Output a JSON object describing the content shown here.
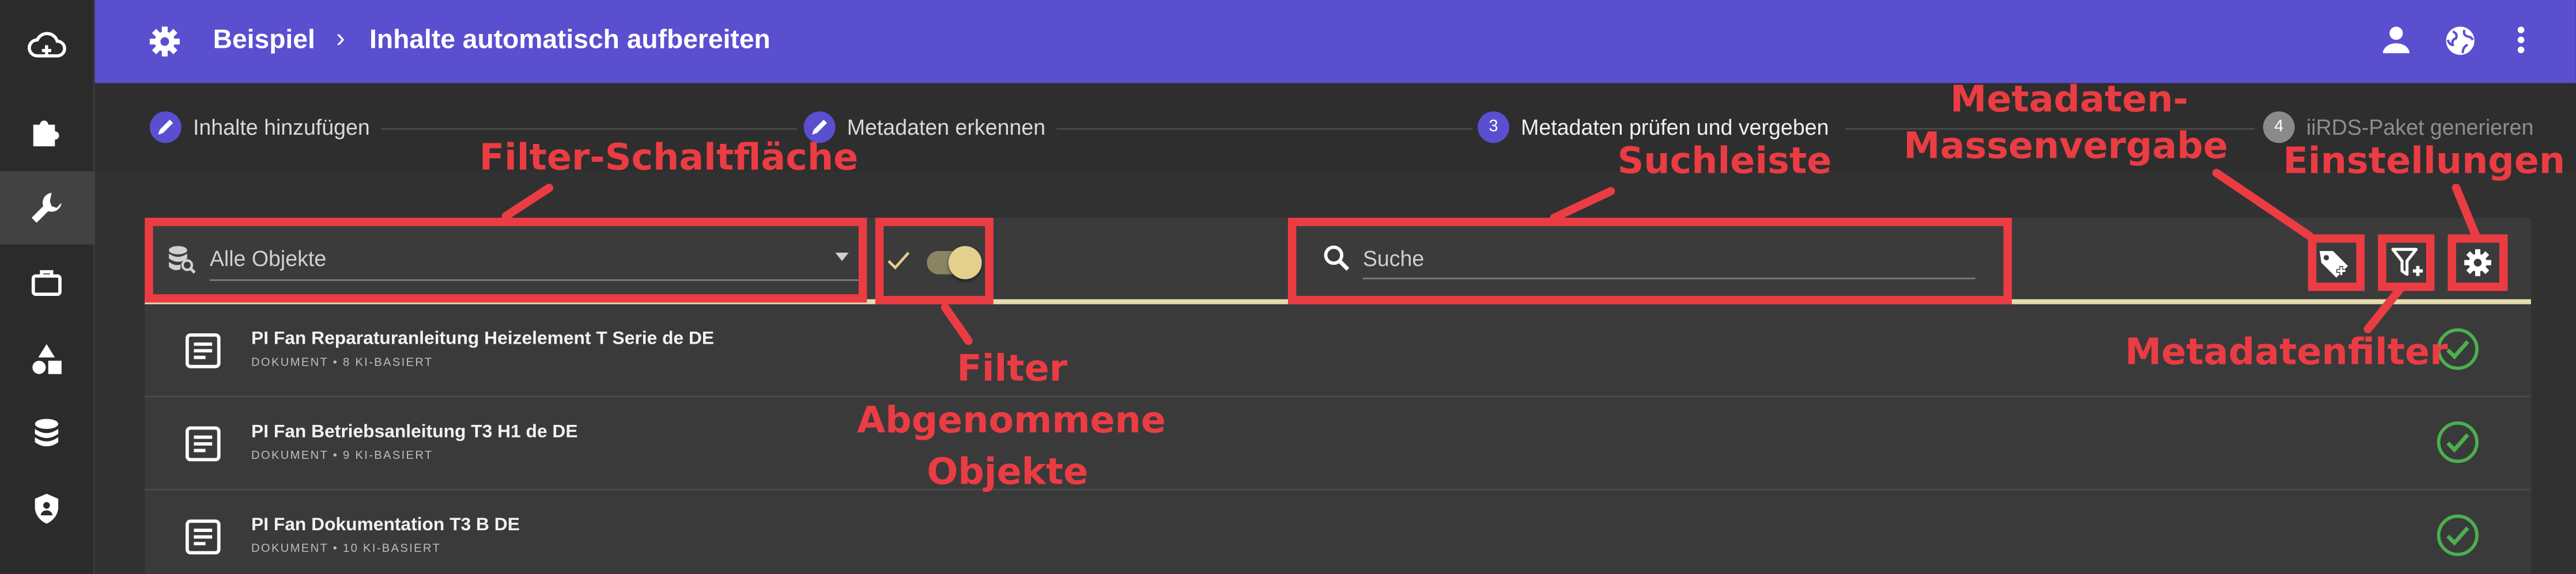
{
  "header": {
    "crumb_root": "Beispiel",
    "crumb_sep": "›",
    "crumb_current": "Inhalte automatisch aufbereiten",
    "bg_color": "#5a4fcf"
  },
  "sidebar": {
    "items": [
      {
        "icon": "cloud-upload-icon"
      },
      {
        "icon": "puzzle-icon"
      },
      {
        "icon": "wrench-icon",
        "active": true
      },
      {
        "icon": "briefcase-icon"
      },
      {
        "icon": "shapes-icon"
      },
      {
        "icon": "database-icon"
      },
      {
        "icon": "shield-icon"
      }
    ]
  },
  "stepper": {
    "steps": [
      {
        "label": "Inhalte hinzufügen",
        "state": "done"
      },
      {
        "label": "Metadaten erkennen",
        "state": "done"
      },
      {
        "number": "3",
        "label": "Metadaten prüfen und vergeben",
        "state": "active"
      },
      {
        "number": "4",
        "label": "iiRDS-Paket generieren",
        "state": "pending"
      }
    ]
  },
  "toolbar": {
    "filter_value": "Alle Objekte",
    "search_placeholder": "Suche",
    "accepted_filter_enabled": true,
    "accent_color": "#e4dcae"
  },
  "rows": [
    {
      "title": "PI Fan Reparaturanleitung Heizelement T Serie de DE",
      "meta": "DOKUMENT • 8 KI-BASIERT",
      "status": "accepted"
    },
    {
      "title": "PI Fan Betriebsanleitung T3 H1 de DE",
      "meta": "DOKUMENT • 9 KI-BASIERT",
      "status": "accepted"
    },
    {
      "title": "PI Fan Dokumentation T3 B DE",
      "meta": "DOKUMENT • 10 KI-BASIERT",
      "status": "accepted"
    }
  ],
  "annotations": {
    "filter_button": "Filter-Schaltfläche",
    "search_bar": "Suchleiste",
    "bulk_metadata_line1": "Metadaten-",
    "bulk_metadata_line2": "Massenvergabe",
    "settings": "Einstellungen",
    "accepted_filter_line1": "Filter",
    "accepted_filter_line2": "Abgenommene",
    "accepted_filter_line3": "Objekte",
    "metadata_filter": "Metadatenfilter",
    "color": "#ec3c43"
  }
}
